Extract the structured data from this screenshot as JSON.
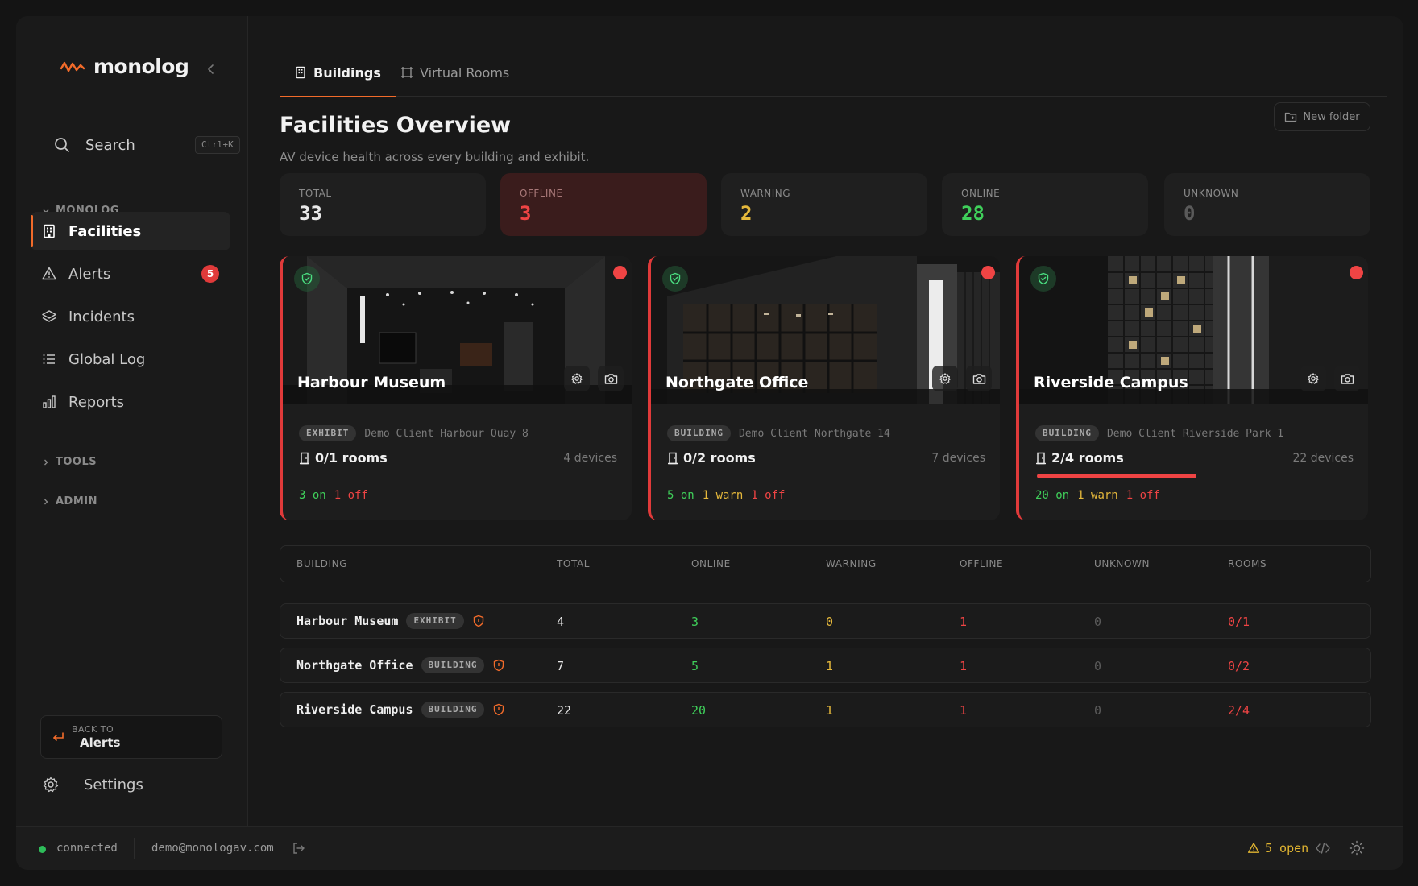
{
  "brand": {
    "name": "monolog",
    "accent": "#f26b2a"
  },
  "search": {
    "label": "Search",
    "shortcut": "Ctrl+K"
  },
  "sidebar": {
    "section_main": "MONOLOG",
    "items": [
      {
        "label": "Facilities",
        "icon": "building-icon",
        "active": true
      },
      {
        "label": "Alerts",
        "icon": "warning-triangle-icon",
        "badge": "5"
      },
      {
        "label": "Incidents",
        "icon": "layers-icon"
      },
      {
        "label": "Global Log",
        "icon": "list-icon"
      },
      {
        "label": "Reports",
        "icon": "bar-chart-icon"
      }
    ],
    "section_tools": "TOOLS",
    "section_admin": "ADMIN",
    "back": {
      "small": "BACK TO",
      "label": "Alerts"
    },
    "settings": "Settings"
  },
  "tabs": [
    {
      "label": "Buildings",
      "active": true
    },
    {
      "label": "Virtual Rooms",
      "active": false
    }
  ],
  "page": {
    "title": "Facilities Overview",
    "subtitle": "AV device health across every building and exhibit.",
    "new_folder": "New folder"
  },
  "stats": [
    {
      "key": "TOTAL",
      "value": "33",
      "color": "#e8e8e8"
    },
    {
      "key": "OFFLINE",
      "value": "3",
      "color": "#ef4444"
    },
    {
      "key": "WARNING",
      "value": "2",
      "color": "#e5b83b"
    },
    {
      "key": "ONLINE",
      "value": "28",
      "color": "#3fcf5a"
    },
    {
      "key": "UNKNOWN",
      "value": "0",
      "color": "#5a5a5a"
    }
  ],
  "cards": [
    {
      "title": "Harbour Museum",
      "tag": "EXHIBIT",
      "client": "Demo Client Harbour Quay 8",
      "rooms": "0/1 rooms",
      "devices": "4 devices",
      "status": [
        {
          "text": "3 on",
          "tone": "green"
        },
        {
          "text": "1 off",
          "tone": "red"
        }
      ]
    },
    {
      "title": "Northgate Office",
      "tag": "BUILDING",
      "client": "Demo Client Northgate 14",
      "rooms": "0/2 rooms",
      "devices": "7 devices",
      "status": [
        {
          "text": "5 on",
          "tone": "green"
        },
        {
          "text": "1 warn",
          "tone": "yellow"
        },
        {
          "text": "1 off",
          "tone": "red"
        }
      ]
    },
    {
      "title": "Riverside Campus",
      "tag": "BUILDING",
      "client": "Demo Client Riverside Park 1",
      "rooms": "2/4 rooms",
      "devices": "22 devices",
      "rooms_progress": 0.5,
      "status": [
        {
          "text": "20 on",
          "tone": "green"
        },
        {
          "text": "1 warn",
          "tone": "yellow"
        },
        {
          "text": "1 off",
          "tone": "red"
        }
      ]
    }
  ],
  "table": {
    "headers": [
      "BUILDING",
      "TOTAL",
      "ONLINE",
      "WARNING",
      "OFFLINE",
      "UNKNOWN",
      "ROOMS"
    ],
    "rows": [
      {
        "name": "Harbour Museum",
        "tag": "EXHIBIT",
        "total": "4",
        "online": "3",
        "warning": "0",
        "offline": "1",
        "unknown": "0",
        "rooms": "0/1"
      },
      {
        "name": "Northgate Office",
        "tag": "BUILDING",
        "total": "7",
        "online": "5",
        "warning": "1",
        "offline": "1",
        "unknown": "0",
        "rooms": "0/2"
      },
      {
        "name": "Riverside Campus",
        "tag": "BUILDING",
        "total": "22",
        "online": "20",
        "warning": "1",
        "offline": "1",
        "unknown": "0",
        "rooms": "2/4"
      }
    ]
  },
  "footer": {
    "status": "connected",
    "email": "demo@monologav.com",
    "open": "5 open"
  }
}
